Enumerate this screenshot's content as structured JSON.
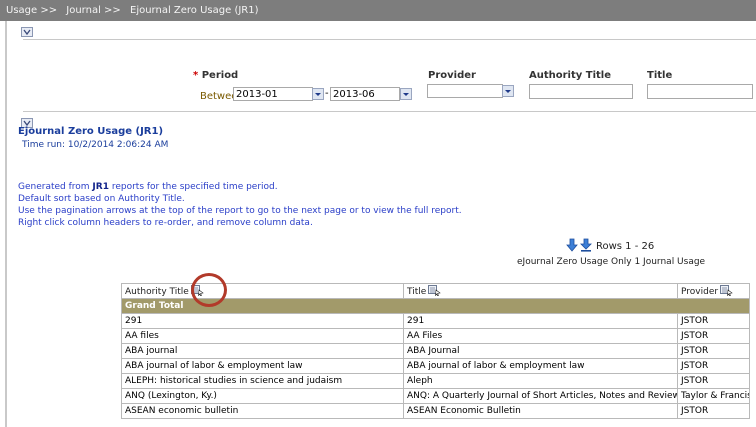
{
  "breadcrumb": {
    "items": [
      "Usage >>",
      "Journal >>",
      "Ejournal Zero Usage (JR1)"
    ]
  },
  "prompts": {
    "period_label": "Period",
    "required_mark": "*",
    "between_label": "Between",
    "period_from": "2013-01",
    "period_to": "2013-06",
    "range_sep": "-",
    "provider_label": "Provider",
    "provider_value": "",
    "authority_title_label": "Authority Title",
    "authority_title_value": "",
    "title_label": "Title",
    "title_value": ""
  },
  "report": {
    "title": "Ejournal Zero Usage (JR1)",
    "time_run": "Time run: 10/2/2014 2:06:24 AM",
    "generated_pre": "Generated from ",
    "generated_bold": "JR1",
    "generated_post": " reports for the specified time period.",
    "line2": "Default sort based on Authority Title.",
    "line3": "Use the pagination arrows at the top of the report to go to the next page or to view the full report.",
    "line4": "Right click column headers to re-order, and remove column data.",
    "rows_label": "Rows 1 - 26",
    "view_name": "eJournal Zero Usage Only 1 Journal Usage"
  },
  "table": {
    "columns": [
      "Authority Title",
      "Title",
      "Provider"
    ],
    "grand_total": "Grand Total",
    "rows": [
      [
        "291",
        "291",
        "JSTOR"
      ],
      [
        "AA files",
        "AA Files",
        "JSTOR"
      ],
      [
        "ABA journal",
        "ABA Journal",
        "JSTOR"
      ],
      [
        "ABA journal of labor & employment law",
        "ABA journal of labor & employment law",
        "JSTOR"
      ],
      [
        "ALEPH: historical studies in science and judaism",
        "Aleph",
        "JSTOR"
      ],
      [
        "ANQ (Lexington, Ky.)",
        "ANQ: A Quarterly Journal of Short Articles, Notes and Reviews",
        "Taylor & Francis"
      ],
      [
        "ASEAN economic bulletin",
        "ASEAN Economic Bulletin",
        "JSTOR"
      ]
    ]
  },
  "colors": {
    "topbar": "#7d7d7d",
    "report_title": "#1a3d9c",
    "grand_total_bg": "#a29a6a",
    "annotation": "#b23a2a"
  }
}
